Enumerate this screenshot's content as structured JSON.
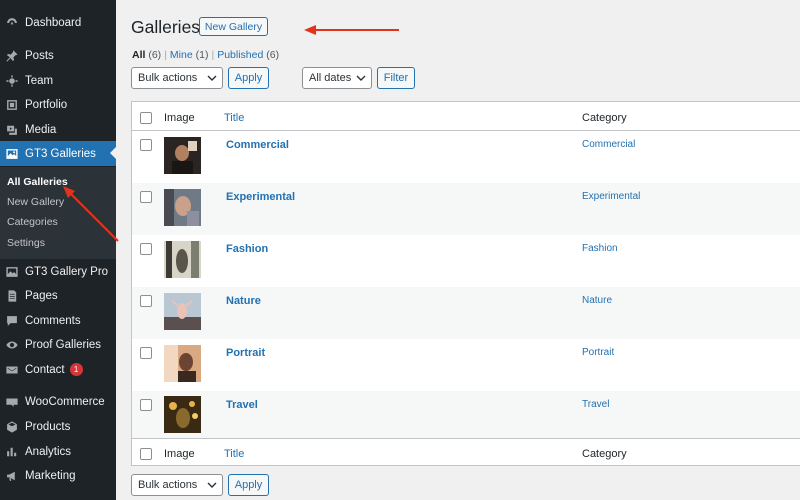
{
  "sidebar": {
    "items": [
      {
        "label": "Dashboard",
        "icon": "dashboard-icon"
      },
      {
        "label": "Posts",
        "icon": "pin-icon"
      },
      {
        "label": "Team",
        "icon": "gear-icon"
      },
      {
        "label": "Portfolio",
        "icon": "portfolio-icon"
      },
      {
        "label": "Media",
        "icon": "media-icon"
      },
      {
        "label": "GT3 Galleries",
        "icon": "gallery-icon"
      },
      {
        "label": "GT3 Gallery Pro",
        "icon": "gallery-pro-icon"
      },
      {
        "label": "Pages",
        "icon": "pages-icon"
      },
      {
        "label": "Comments",
        "icon": "comments-icon"
      },
      {
        "label": "Proof Galleries",
        "icon": "eye-icon"
      },
      {
        "label": "Contact",
        "icon": "mail-icon",
        "badge": "1"
      },
      {
        "label": "WooCommerce",
        "icon": "woo-icon"
      },
      {
        "label": "Products",
        "icon": "box-icon"
      },
      {
        "label": "Analytics",
        "icon": "analytics-icon"
      },
      {
        "label": "Marketing",
        "icon": "megaphone-icon"
      }
    ],
    "submenu": [
      {
        "label": "All Galleries"
      },
      {
        "label": "New Gallery"
      },
      {
        "label": "Categories"
      },
      {
        "label": "Settings"
      }
    ]
  },
  "header": {
    "title": "Galleries",
    "new_button": "New Gallery"
  },
  "filters": {
    "all_label": "All",
    "all_count": "(6)",
    "mine_label": "Mine",
    "mine_count": "(1)",
    "published_label": "Published",
    "published_count": "(6)",
    "sep": "|",
    "bulk_actions": "Bulk actions",
    "apply": "Apply",
    "all_dates": "All dates",
    "filter": "Filter"
  },
  "table": {
    "columns": {
      "image": "Image",
      "title": "Title",
      "category": "Category"
    },
    "rows": [
      {
        "title": "Commercial",
        "category": "Commercial",
        "thumb_colors": [
          "#2a2522",
          "#b08060",
          "#e0d0c0"
        ]
      },
      {
        "title": "Experimental",
        "category": "Experimental",
        "thumb_colors": [
          "#6f7a86",
          "#c9a08a",
          "#4a4a52"
        ]
      },
      {
        "title": "Fashion",
        "category": "Fashion",
        "thumb_colors": [
          "#7c7f70",
          "#d8d4c8",
          "#3b3a34"
        ]
      },
      {
        "title": "Nature",
        "category": "Nature",
        "thumb_colors": [
          "#b9c7d3",
          "#e9c2b8",
          "#5a5050"
        ]
      },
      {
        "title": "Portrait",
        "category": "Portrait",
        "thumb_colors": [
          "#d9a982",
          "#6b4434",
          "#f2d8c0"
        ]
      },
      {
        "title": "Travel",
        "category": "Travel",
        "thumb_colors": [
          "#3a2a14",
          "#e6b34a",
          "#8a6a2c"
        ]
      }
    ]
  },
  "colors": {
    "sidebar_bg": "#1d2327",
    "accent": "#2271b1",
    "annotation_arrow": "#e2341d"
  }
}
